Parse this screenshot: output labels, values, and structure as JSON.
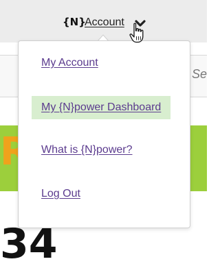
{
  "header": {
    "brand_mark": "{N}",
    "account_label": "Account",
    "chevron_icon": "chevron-down-icon",
    "cursor_icon": "hand-pointer-icon"
  },
  "background": {
    "search_hint": "Se",
    "promo_letter": "R",
    "big_number": "34"
  },
  "dropdown": {
    "items": [
      {
        "label": "My Account"
      },
      {
        "label": "My {N}power Dashboard",
        "highlighted": true
      },
      {
        "label": "What is {N}power?"
      },
      {
        "label": "Log Out"
      }
    ]
  },
  "colors": {
    "link": "#5b3b8e",
    "highlight": "#d8eecf",
    "header_bg": "#ececec",
    "promo_bg": "#9ccf3c"
  }
}
